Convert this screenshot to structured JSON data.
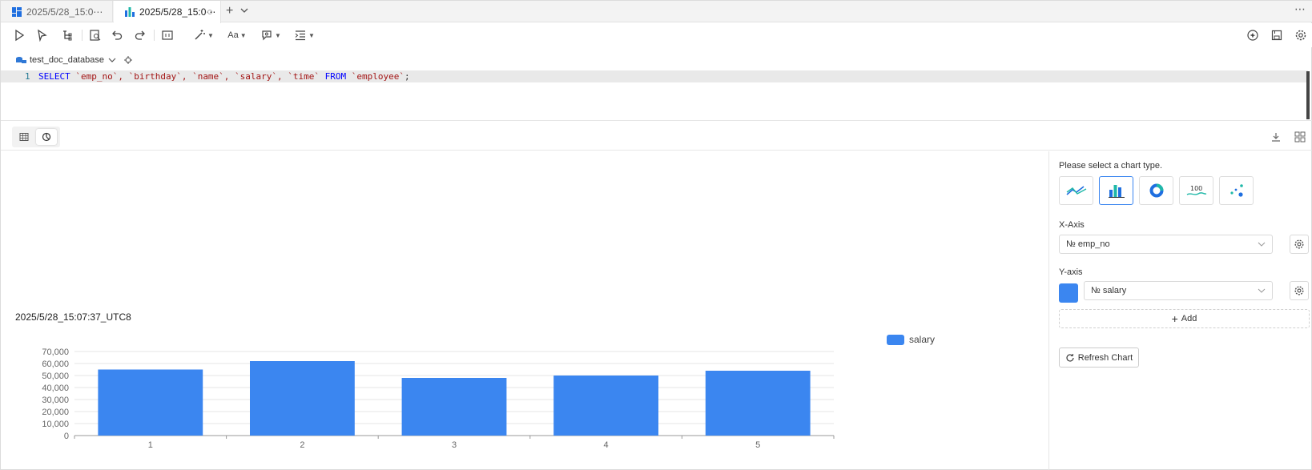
{
  "tabs": [
    {
      "label": "2025/5/28_15:0⋯"
    },
    {
      "label": "2025/5/28_15:0⋯"
    }
  ],
  "toolbar": {
    "more_label": "⋯"
  },
  "editor": {
    "database": "test_doc_database",
    "line_number": "1",
    "sql": {
      "kw1": "SELECT",
      "cols": " `emp_no`, `birthday`, `name`, `salary`, `time` ",
      "kw2": "FROM",
      "table": " `employee`",
      "end": ";"
    }
  },
  "chart_panel": {
    "prompt": "Please select a chart type.",
    "chart_types": [
      "line-chart-icon",
      "bar-chart-icon",
      "donut-chart-icon",
      "metric-chart-icon",
      "scatter-chart-icon"
    ],
    "selected_type": "bar",
    "x_axis_label": "X-Axis",
    "x_axis_value": "№ emp_no",
    "y_axis_label": "Y-axis",
    "y_axis_value": "№ salary",
    "y_axis_color": "#3b86f0",
    "add_label": "Add",
    "refresh_label": "Refresh Chart"
  },
  "chart_data": {
    "type": "bar",
    "title": "2025/5/28_15:07:37_UTC8",
    "categories": [
      "1",
      "2",
      "3",
      "4",
      "5"
    ],
    "series": [
      {
        "name": "salary",
        "values": [
          55000,
          62000,
          48000,
          50000,
          54000
        ],
        "color": "#3b86f0"
      }
    ],
    "ylim": [
      0,
      70000
    ],
    "yticks": [
      "0",
      "10,000",
      "20,000",
      "30,000",
      "40,000",
      "50,000",
      "60,000",
      "70,000"
    ],
    "ytick_values": [
      0,
      10000,
      20000,
      30000,
      40000,
      50000,
      60000,
      70000
    ],
    "grid": true,
    "legend": "top-right"
  }
}
